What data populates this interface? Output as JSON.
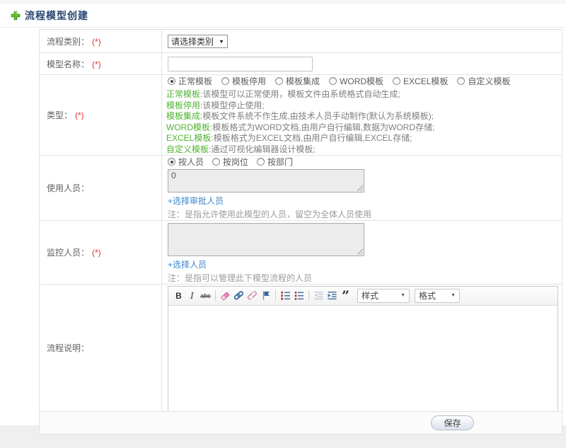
{
  "header": {
    "title": "流程模型创建"
  },
  "colors": {
    "green_text": "#50b332",
    "link_blue": "#3b86c8",
    "required_red": "#e53333",
    "title_navy": "#274672",
    "plus_green": "#55b42e"
  },
  "form": {
    "category": {
      "label": "流程类别：",
      "required": "(*)",
      "select_value": "请选择类别"
    },
    "name": {
      "label": "模型名称：",
      "required": "(*)",
      "input_value": ""
    },
    "type": {
      "label": "类型：",
      "required": "(*)",
      "options": [
        "正常模板",
        "模板停用",
        "模板集成",
        "WORD模板",
        "EXCEL模板",
        "自定义模板"
      ],
      "selected": "正常模板",
      "descriptions": [
        {
          "term": "正常模板",
          "text": ":该模型可以正常使用，模板文件由系统格式自动生成;"
        },
        {
          "term": "模板停用",
          "text": ":该模型停止使用;"
        },
        {
          "term": "模板集成",
          "text": ":模板文件系统不作生成,由技术人员手动制作(默认为系统模板);"
        },
        {
          "term": "WORD模板",
          "text": ":模板格式为WORD文档,由用户自行编辑,数据为WORD存储;"
        },
        {
          "term": "EXCEL模板",
          "text": ":模板格式为EXCEL文档,由用户自行编辑,EXCEL存储;"
        },
        {
          "term": "自定义模板",
          "text": ":通过可视化编辑器设计模板;"
        }
      ]
    },
    "users": {
      "label": "使用人员：",
      "options": [
        "按人员",
        "按岗位",
        "按部门"
      ],
      "selected": "按人员",
      "textarea_value": "0",
      "link": "+选择审批人员",
      "note": "注：是指允许使用此模型的人员，留空为全体人员使用"
    },
    "monitors": {
      "label": "监控人员：",
      "required": "(*)",
      "textarea_value": "",
      "link": "+选择人员",
      "note": "注：是指可以管理此下模型流程的人员"
    },
    "description": {
      "label": "流程说明：",
      "editor": {
        "styles_label": "样式",
        "format_label": "格式",
        "buttons": [
          "bold",
          "italic",
          "strikethrough",
          "remove-format",
          "link",
          "unlink",
          "anchor",
          "numbered-list",
          "bulleted-list",
          "outdent",
          "indent",
          "blockquote"
        ]
      }
    }
  },
  "footer": {
    "save_label": "保存"
  }
}
